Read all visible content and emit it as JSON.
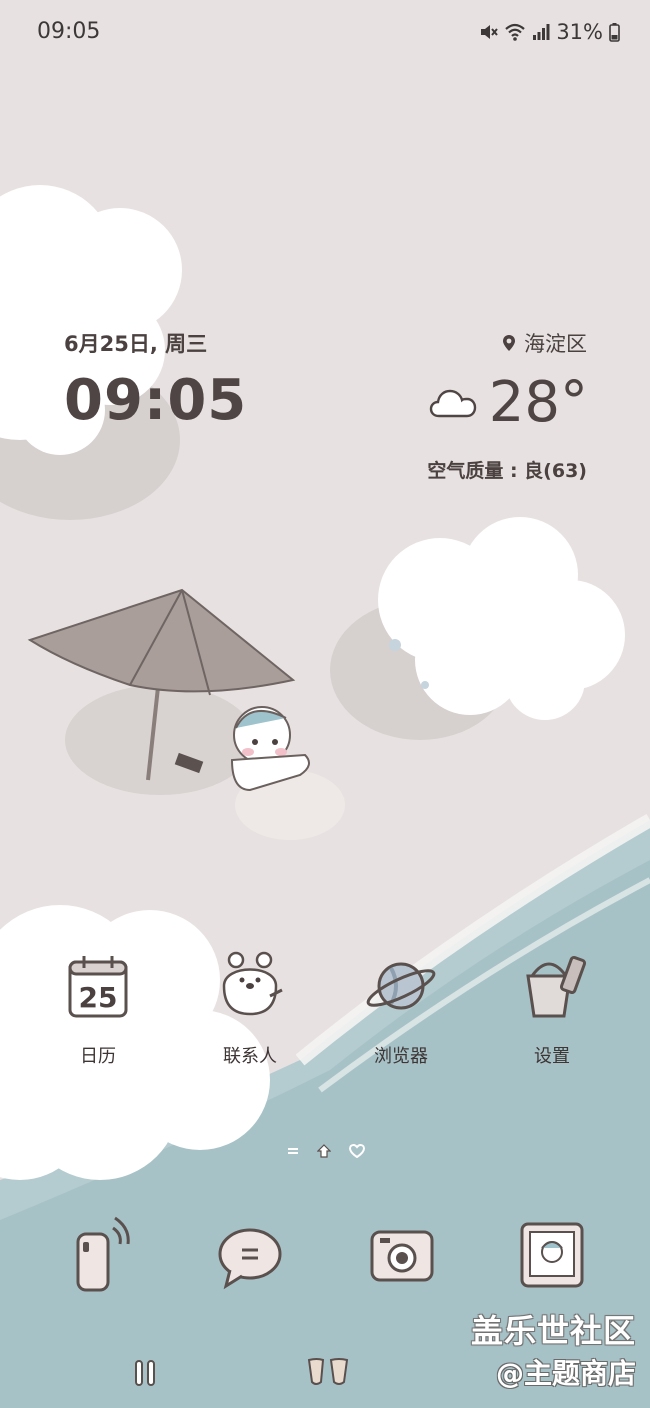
{
  "status_bar": {
    "time": "09:05",
    "battery": "31%",
    "icons": [
      "mute-icon",
      "wifi-icon",
      "signal-icon",
      "battery-icon"
    ]
  },
  "clock_widget": {
    "date": "6月25日, 周三",
    "time": "09:05"
  },
  "weather_widget": {
    "location": "海淀区",
    "temperature": "28°",
    "condition_icon": "cloud-icon",
    "air_quality": "空气质量 : 良(63)"
  },
  "apps": [
    {
      "label": "日历",
      "icon": "calendar-icon",
      "icon_text": "25"
    },
    {
      "label": "联系人",
      "icon": "contacts-bear-icon"
    },
    {
      "label": "浏览器",
      "icon": "planet-browser-icon"
    },
    {
      "label": "设置",
      "icon": "bucket-settings-icon"
    }
  ],
  "page_indicator": [
    "menu-indicator",
    "home-indicator",
    "heart-indicator"
  ],
  "dock": [
    {
      "icon": "phone-icon"
    },
    {
      "icon": "messages-icon"
    },
    {
      "icon": "camera-icon"
    },
    {
      "icon": "gallery-icon"
    }
  ],
  "watermark": {
    "line1": "盖乐世社区",
    "line2": "@主题商店"
  },
  "colors": {
    "sand": "#e6e1e0",
    "sea": "#a9c4c8",
    "text": "#4f4544",
    "cloud": "#ffffff"
  }
}
